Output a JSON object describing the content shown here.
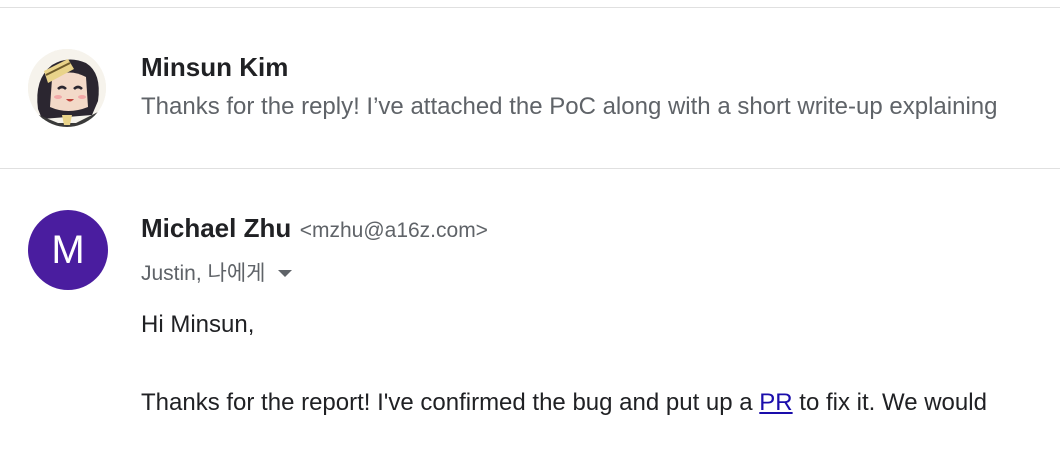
{
  "collapsed_message": {
    "sender": "Minsun Kim",
    "snippet": "Thanks for the reply! I’ve attached the PoC along with a short write-up explaining"
  },
  "expanded_message": {
    "avatar_letter": "M",
    "avatar_color": "#4a1d9f",
    "sender_name": "Michael Zhu",
    "sender_email": "<mzhu@a16z.com>",
    "recipients": "Justin, 나에게",
    "recipients_toggle_icon": "caret-down-icon",
    "greeting": "Hi Minsun,",
    "body_before_link": "Thanks for the report! I've confirmed the bug and put up a ",
    "link_text": "PR",
    "body_after_link": " to fix it. We would"
  },
  "colors": {
    "link": "#1a0dab",
    "secondary_text": "#5f6368",
    "divider": "#e0e0e0"
  }
}
